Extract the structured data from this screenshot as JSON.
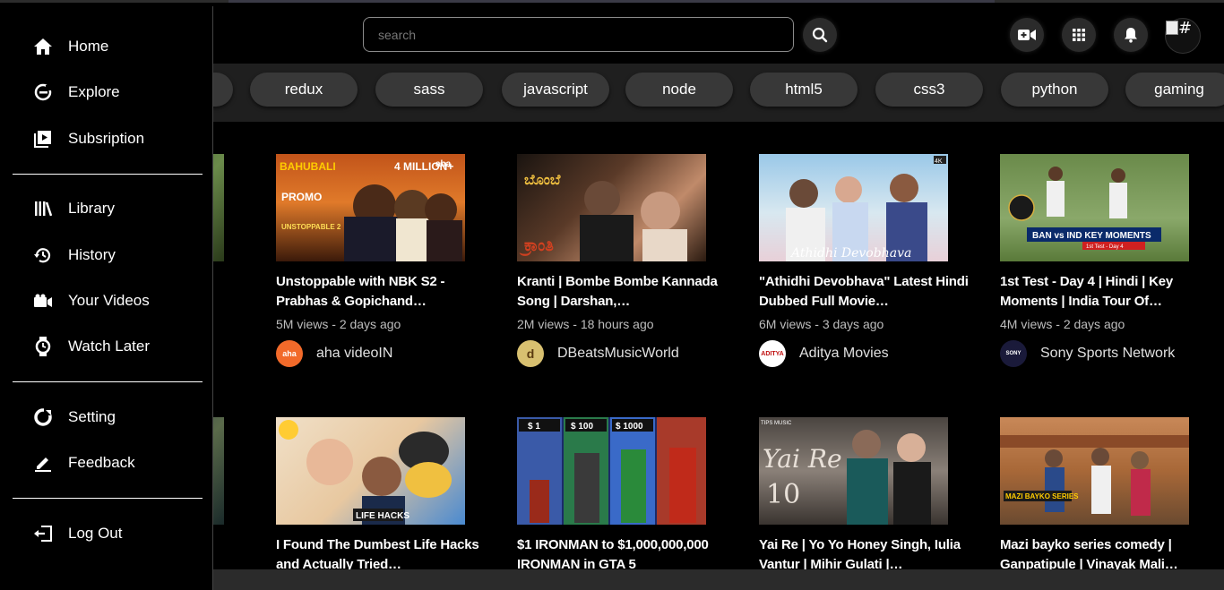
{
  "search": {
    "placeholder": "search"
  },
  "chips": [
    "",
    "redux",
    "sass",
    "javascript",
    "node",
    "html5",
    "css3",
    "python",
    "gaming"
  ],
  "header": {
    "avatar_alt": "#"
  },
  "sidebar": {
    "items": [
      {
        "label": "Home"
      },
      {
        "label": "Explore"
      },
      {
        "label": "Subsription"
      },
      {
        "label": "Library"
      },
      {
        "label": "History"
      },
      {
        "label": "Your Videos"
      },
      {
        "label": "Watch Later"
      },
      {
        "label": "Setting"
      },
      {
        "label": "Feedback"
      },
      {
        "label": "Log Out"
      }
    ]
  },
  "videos": [
    {
      "title": "Unstoppable with NBK S2 - Prabhas & Gopichand…",
      "views": "5M views",
      "age": "2 days ago",
      "channel": "aha videoIN",
      "thumb_text": "BAHUBALI PROMO UNSTOPPABLE 2 4 MILLION+ aha"
    },
    {
      "title": "Kranti | Bombe Bombe Kannada Song | Darshan,…",
      "views": "2M views",
      "age": "18 hours ago",
      "channel": "DBeatsMusicWorld",
      "thumb_text": "ಬೊಂಬೆ ಬೊಂಬೆ ಕ್ರಾಂತಿ"
    },
    {
      "title": "\"Athidhi Devobhava\" Latest Hindi Dubbed Full Movie…",
      "views": "6M views",
      "age": "3 days ago",
      "channel": "Aditya Movies",
      "thumb_text": "Athidhi Devobhava 4K ADITYA"
    },
    {
      "title": "1st Test - Day 4 | Hindi | Key Moments | India Tour Of…",
      "views": "4M views",
      "age": "2 days ago",
      "channel": "Sony Sports Network",
      "thumb_text": "BAN vs IND KEY MOMENTS 1st Test - Day 4 3+ MILLION VIEWS"
    },
    {
      "title": "I Found The Dumbest Life Hacks and Actually Tried…",
      "views": "",
      "age": "",
      "channel": "",
      "thumb_text": "LIFE HACKS TOILET SEAT"
    },
    {
      "title": "$1 IRONMAN to $1,000,000,000 IRONMAN in GTA 5",
      "views": "",
      "age": "",
      "channel": "",
      "thumb_text": "$1 $100 $1000"
    },
    {
      "title": "Yai Re | Yo Yo Honey Singh, Iulia Vantur | Mihir Gulati |…",
      "views": "",
      "age": "",
      "channel": "",
      "thumb_text": "Yai Re 10 MILLION VIEWS TIPS MUSIC"
    },
    {
      "title": "Mazi bayko series comedy | Ganpatipule | Vinayak Mali…",
      "views": "",
      "age": "",
      "channel": "",
      "thumb_text": "MAZI BAYKO SERIES गणपतीपुळे"
    }
  ],
  "colors": {
    "background": "#000000",
    "chip": "#383838",
    "chips_bar": "#1f1f1f",
    "button": "#2b2b2b"
  },
  "icons": {
    "search_button": "search-icon",
    "create": "video-camera-icon",
    "apps": "grid-icon",
    "notifications": "bell-icon"
  }
}
